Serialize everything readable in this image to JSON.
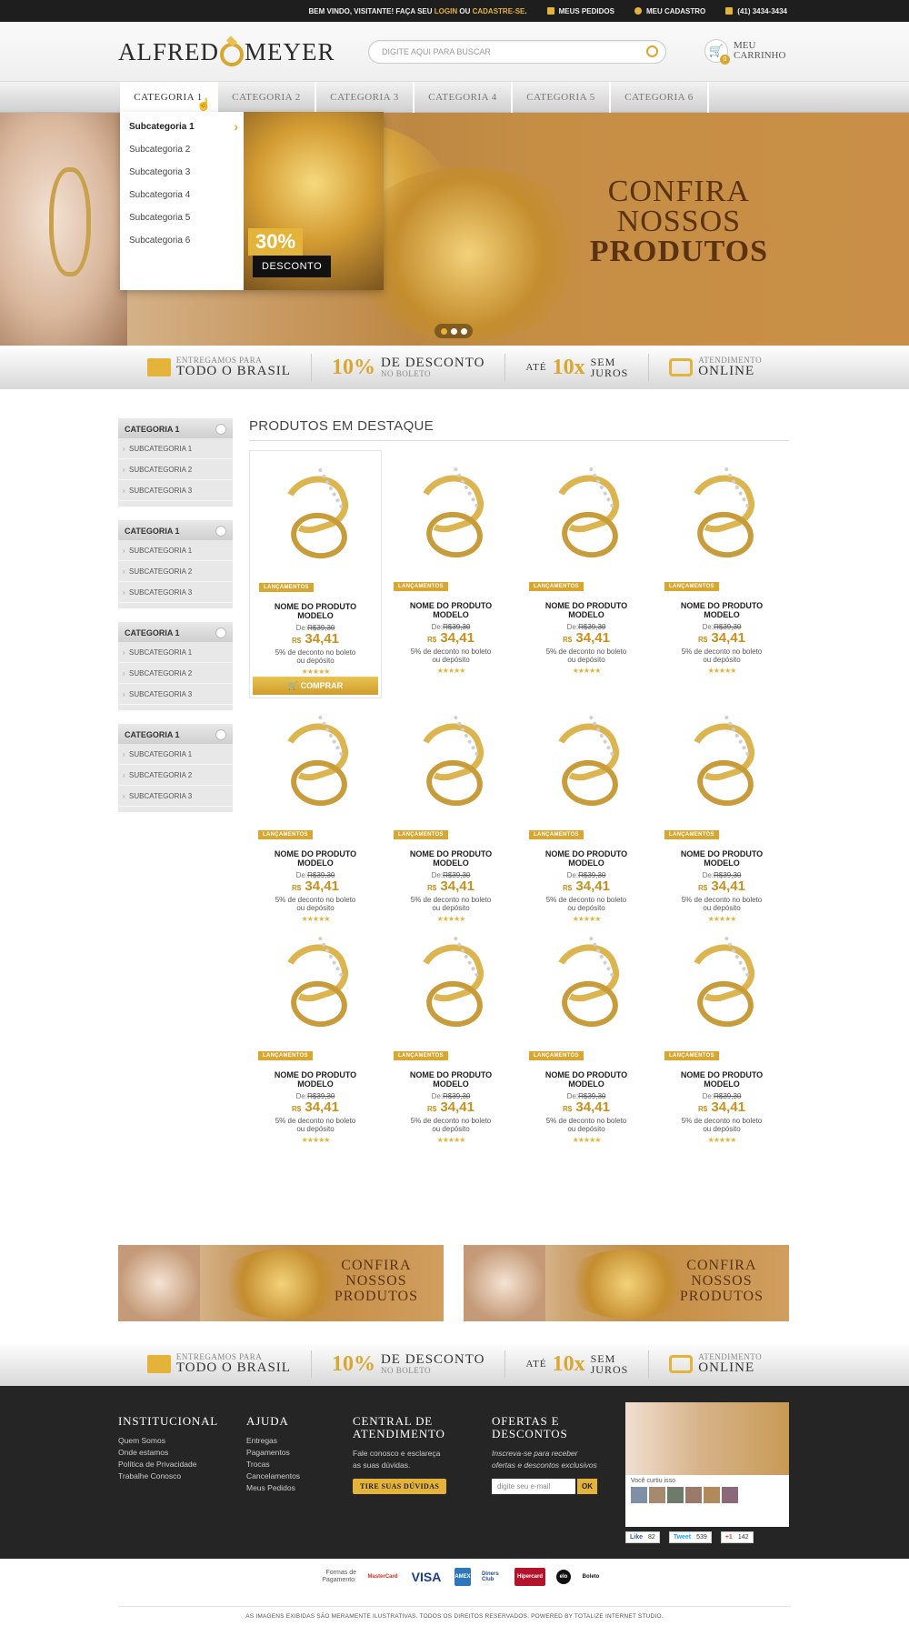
{
  "topbar": {
    "welcome_prefix": "BEM VINDO, VISITANTE! FAÇA SEU",
    "login": "LOGIN",
    "or": "OU",
    "register": "CADASTRE-SE",
    "dot": ".",
    "orders": "MEUS PEDIDOS",
    "account": "MEU CADASTRO",
    "phone": "(41) 3434-3434"
  },
  "header": {
    "logo_left": "ALFRED",
    "logo_right": "MEYER",
    "search_placeholder": "DIGITE AQUI PARA BUSCAR",
    "cart_label": "MEU CARRINHO",
    "cart_count": "0"
  },
  "nav": {
    "tabs": [
      "CATEGORIA 1",
      "CATEGORIA 2",
      "CATEGORIA 3",
      "CATEGORIA 4",
      "CATEGORIA 5",
      "CATEGORIA 6"
    ],
    "active_index": 0
  },
  "dropdown": {
    "items": [
      "Subcategoria 1",
      "Subcategoria 2",
      "Subcategoria 3",
      "Subcategoria 4",
      "Subcategoria 5",
      "Subcategoria 6"
    ],
    "promo_percent": "30%",
    "promo_label": "DESCONTO"
  },
  "hero": {
    "line1": "CONFIRA",
    "line2": "NOSSOS",
    "line3": "PRODUTOS",
    "slides": 3,
    "active_slide": 0
  },
  "features": {
    "shipping_small": "ENTREGAMOS PARA",
    "shipping_big": "TODO O BRASIL",
    "discount_pct": "10%",
    "discount_big": "DE DESCONTO",
    "discount_small": "NO BOLETO",
    "installments_pre": "ATÉ",
    "installments_big": "10x",
    "installments_small1": "SEM",
    "installments_small2": "JUROS",
    "support_small": "ATENDIMENTO",
    "support_big": "ONLINE"
  },
  "sidebar": {
    "boxes": [
      {
        "title": "CATEGORIA 1",
        "items": [
          "SUBCATEGORIA 1",
          "SUBCATEGORIA 2",
          "SUBCATEGORIA 3"
        ]
      },
      {
        "title": "CATEGORIA 1",
        "items": [
          "SUBCATEGORIA 1",
          "SUBCATEGORIA 2",
          "SUBCATEGORIA 3"
        ]
      },
      {
        "title": "CATEGORIA 1",
        "items": [
          "SUBCATEGORIA 1",
          "SUBCATEGORIA 2",
          "SUBCATEGORIA 3"
        ]
      },
      {
        "title": "CATEGORIA 1",
        "items": [
          "SUBCATEGORIA 1",
          "SUBCATEGORIA 2",
          "SUBCATEGORIA 3"
        ]
      }
    ]
  },
  "products": {
    "section_title": "PRODUTOS EM DESTAQUE",
    "tag": "LANÇAMENTOS",
    "name_line1": "NOME DO PRODUTO",
    "name_line2": "MODELO",
    "old_prefix": "De:",
    "old_price": "R$39,30",
    "currency": "R$",
    "price": "34,41",
    "discount_line1": "5% de deconto no boleto",
    "discount_line2": "ou depósito",
    "stars": "★★★★★",
    "buy_label": "COMPRAR",
    "count": 12,
    "selected_index": 0
  },
  "banners": [
    {
      "line1": "CONFIRA",
      "line2": "NOSSOS",
      "line3": "PRODUTOS"
    },
    {
      "line1": "CONFIRA",
      "line2": "NOSSOS",
      "line3": "PRODUTOS"
    }
  ],
  "footer": {
    "institucional": {
      "title": "INSTITUCIONAL",
      "links": [
        "Quem Somos",
        "Onde estamos",
        "Política de Privacidade",
        "Trabalhe Conosco"
      ]
    },
    "ajuda": {
      "title": "AJUDA",
      "links": [
        "Entregas",
        "Pagamentos",
        "Trocas",
        "Cancelamentos",
        "Meus Pedidos"
      ]
    },
    "central": {
      "title1": "CENTRAL DE",
      "title2": "ATENDIMENTO",
      "text1": "Fale conosco e esclareça",
      "text2": "as suas dúvidas.",
      "button": "TIRE SUAS DÚVIDAS"
    },
    "ofertas": {
      "title1": "OFERTAS E",
      "title2": "DESCONTOS",
      "text1": "Inscreva-se para receber",
      "text2": "ofertas e descontos exclusivos",
      "email_placeholder": "digite seu e-mail",
      "ok": "OK"
    },
    "facebook": {
      "caption": "Você curtiu isso"
    },
    "social": {
      "like": "Like",
      "like_count": "82",
      "tweet": "Tweet",
      "tweet_count": "539",
      "plus": "+1",
      "plus_count": "142"
    }
  },
  "payment": {
    "label1": "Formas de",
    "label2": "Pagamento:",
    "methods": [
      "MasterCard",
      "VISA",
      "AMEX",
      "Diners Club",
      "Hipercard",
      "elo",
      "Boleto"
    ],
    "legal": "AS IMAGENS EXIBIDAS SÃO MERAMENTE ILUSTRATIVAS. TODOS OS DIREITOS RESERVADOS. POWERED BY TOTALIZE INTERNET STUDIO."
  },
  "colors": {
    "gold": "#d9a630",
    "dark": "#252525"
  }
}
